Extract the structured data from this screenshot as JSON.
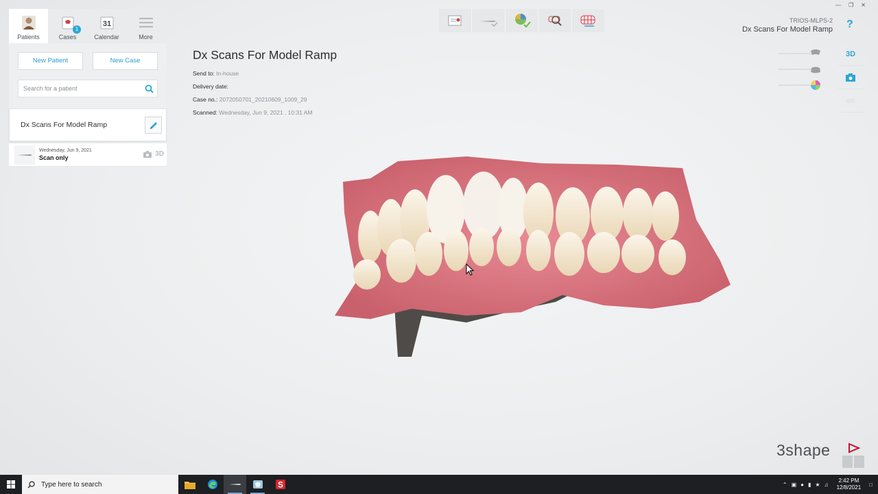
{
  "nav": {
    "items": [
      {
        "label": "Patients",
        "icon": "patients-icon"
      },
      {
        "label": "Cases",
        "icon": "cases-icon",
        "badge": "1"
      },
      {
        "label": "Calendar",
        "icon": "calendar-icon",
        "day": "31"
      },
      {
        "label": "More",
        "icon": "menu-icon"
      }
    ]
  },
  "actions": {
    "new_patient": "New Patient",
    "new_case": "New Case"
  },
  "search": {
    "placeholder": "Search for a patient"
  },
  "patient": {
    "name": "Dx Scans For Model Ramp"
  },
  "case_list": [
    {
      "date": "Wednesday, Jun 9, 2021",
      "type": "Scan only",
      "badge_3d": "3D"
    }
  ],
  "details": {
    "title": "Dx Scans For Model Ramp",
    "send_to_label": "Send to:",
    "send_to_value": "In-house",
    "delivery_label": "Delivery date:",
    "delivery_value": "",
    "case_no_label": "Case no.:",
    "case_no_value": "2072050701_20210609_1009_29",
    "scanned_label": "Scanned:",
    "scanned_value": "Wednesday, Jun 9, 2021 , 10:31 AM"
  },
  "header": {
    "device": "TRIOS-MLPS-2",
    "title": "Dx Scans For Model Ramp",
    "help": "?"
  },
  "side_tools": {
    "view_3d": "3D"
  },
  "brand": {
    "logo": "3shape"
  },
  "taskbar": {
    "search_text": "Type here to search",
    "time": "2:42 PM",
    "date": "12/8/2021"
  },
  "colors": {
    "accent": "#2aa6d6",
    "brand_mark": "#c8102e",
    "taskbar": "#1d1f22"
  }
}
